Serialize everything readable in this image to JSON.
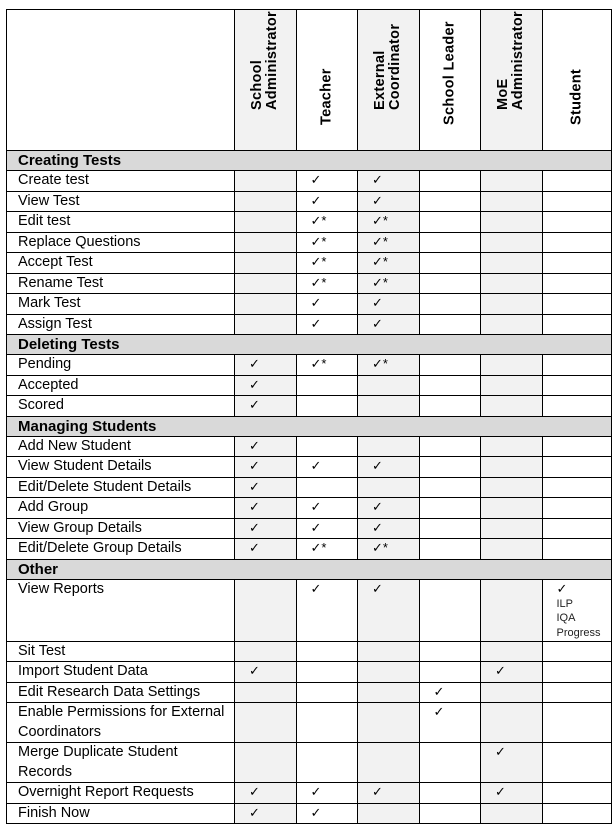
{
  "roles": [
    {
      "id": "school_admin",
      "lines": [
        "School",
        "Administrator"
      ]
    },
    {
      "id": "teacher",
      "lines": [
        "Teacher"
      ]
    },
    {
      "id": "external_coordinator",
      "lines": [
        "External",
        "Coordinator"
      ]
    },
    {
      "id": "school_leader",
      "lines": [
        "School Leader"
      ]
    },
    {
      "id": "moe_admin",
      "lines": [
        "MoE",
        "Administrator"
      ]
    },
    {
      "id": "student",
      "lines": [
        "Student"
      ]
    }
  ],
  "legend": {
    "check": "✓",
    "check_star": "✓*"
  },
  "sections": [
    {
      "title": "Creating Tests",
      "rows": [
        {
          "label": "Create test",
          "cells": [
            "",
            "✓",
            "✓",
            "",
            "",
            ""
          ]
        },
        {
          "label": "View Test",
          "cells": [
            "",
            "✓",
            "✓",
            "",
            "",
            ""
          ]
        },
        {
          "label": "Edit test",
          "cells": [
            "",
            "✓*",
            "✓*",
            "",
            "",
            ""
          ]
        },
        {
          "label": "Replace Questions",
          "cells": [
            "",
            "✓*",
            "✓*",
            "",
            "",
            ""
          ]
        },
        {
          "label": "Accept Test",
          "cells": [
            "",
            "✓*",
            "✓*",
            "",
            "",
            ""
          ]
        },
        {
          "label": "Rename Test",
          "cells": [
            "",
            "✓*",
            "✓*",
            "",
            "",
            ""
          ]
        },
        {
          "label": "Mark Test",
          "cells": [
            "",
            "✓",
            "✓",
            "",
            "",
            ""
          ]
        },
        {
          "label": "Assign Test",
          "cells": [
            "",
            "✓",
            "✓",
            "",
            "",
            ""
          ]
        }
      ]
    },
    {
      "title": "Deleting Tests",
      "rows": [
        {
          "label": "Pending",
          "cells": [
            "✓",
            "✓*",
            "✓*",
            "",
            "",
            ""
          ]
        },
        {
          "label": "Accepted",
          "cells": [
            "✓",
            "",
            "",
            "",
            "",
            ""
          ]
        },
        {
          "label": "Scored",
          "cells": [
            "✓",
            "",
            "",
            "",
            "",
            ""
          ]
        }
      ]
    },
    {
      "title": "Managing Students",
      "rows": [
        {
          "label": "Add New Student",
          "cells": [
            "✓",
            "",
            "",
            "",
            "",
            ""
          ]
        },
        {
          "label": "View Student Details",
          "cells": [
            "✓",
            "✓",
            "✓",
            "",
            "",
            ""
          ]
        },
        {
          "label": "Edit/Delete Student Details",
          "cells": [
            "✓",
            "",
            "",
            "",
            "",
            ""
          ]
        },
        {
          "label": "Add Group",
          "cells": [
            "✓",
            "✓",
            "✓",
            "",
            "",
            ""
          ]
        },
        {
          "label": "View Group Details",
          "cells": [
            "✓",
            "✓",
            "✓",
            "",
            "",
            ""
          ]
        },
        {
          "label": "Edit/Delete Group Details",
          "cells": [
            "✓",
            "✓*",
            "✓*",
            "",
            "",
            ""
          ]
        }
      ]
    },
    {
      "title": "Other",
      "rows": [
        {
          "label": "View Reports",
          "size": "xtall",
          "cells": [
            "",
            "✓",
            "✓",
            "",
            "",
            "✓"
          ],
          "student_notes": [
            "ILP",
            "IQA",
            "Progress"
          ]
        },
        {
          "label": "Sit Test",
          "cells": [
            "",
            "",
            "",
            "",
            "",
            ""
          ]
        },
        {
          "label": "Import Student Data",
          "cells": [
            "✓",
            "",
            "",
            "",
            "✓",
            ""
          ]
        },
        {
          "label": "Edit Research Data Settings",
          "cells": [
            "",
            "",
            "",
            "✓",
            "",
            ""
          ]
        },
        {
          "label": "Enable Permissions for External Coordinators",
          "size": "tall",
          "cells": [
            "",
            "",
            "",
            "✓",
            "",
            ""
          ]
        },
        {
          "label": "Merge Duplicate Student Records",
          "size": "tall",
          "cells": [
            "",
            "",
            "",
            "",
            "✓",
            ""
          ]
        },
        {
          "label": "Overnight Report Requests",
          "cells": [
            "✓",
            "✓",
            "✓",
            "",
            "✓",
            ""
          ]
        },
        {
          "label": "Finish Now",
          "cells": [
            "✓",
            "✓",
            "",
            "",
            "",
            ""
          ]
        }
      ]
    }
  ]
}
